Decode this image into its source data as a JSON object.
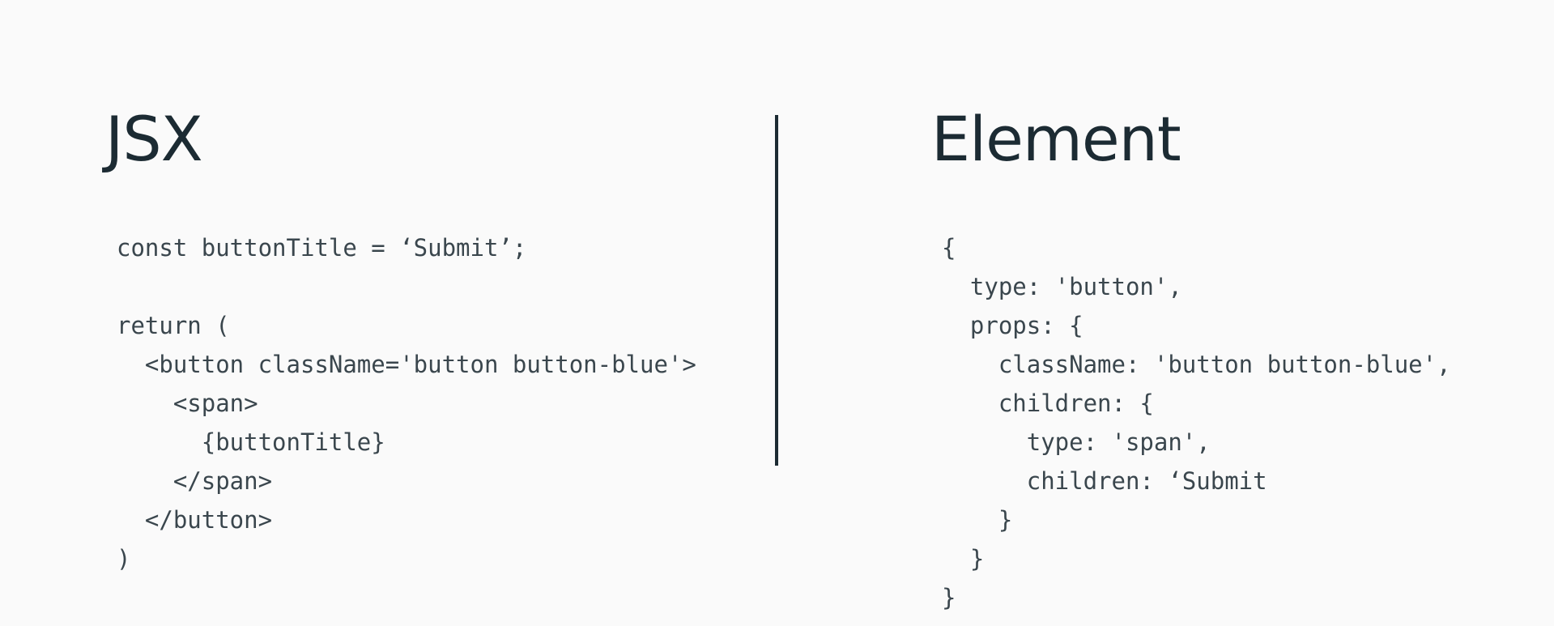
{
  "left_panel": {
    "heading": "JSX",
    "code_lines": [
      "const buttonTitle = ‘Submit’;",
      "",
      "return (",
      "  <button className='button button-blue'>",
      "    <span>",
      "      {buttonTitle}",
      "    </span>",
      "  </button>",
      ")"
    ]
  },
  "right_panel": {
    "heading": "Element",
    "code_lines": [
      "{",
      "  type: 'button',",
      "  props: {",
      "    className: 'button button-blue',",
      "    children: {",
      "      type: 'span',",
      "      children: ‘Submit",
      "    }",
      "  }",
      "}"
    ]
  },
  "colors": {
    "background": "#fafafa",
    "heading": "#1c2b33",
    "code": "#3a464d",
    "divider": "#1c2b33"
  }
}
